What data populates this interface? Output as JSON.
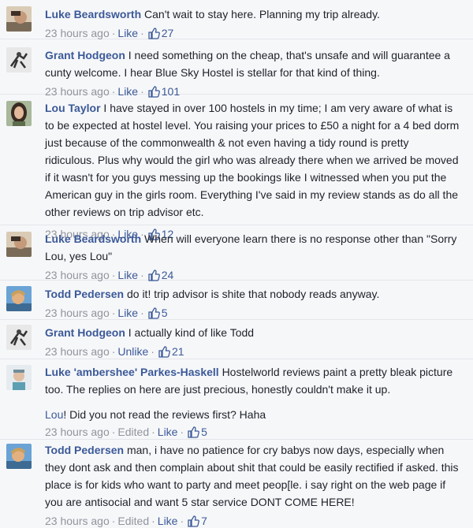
{
  "comments": [
    {
      "author": "Luke Beardsworth",
      "text": "Can't wait to stay here. Planning my trip already.",
      "time": "23 hours ago",
      "action": "Like",
      "likes": "27"
    },
    {
      "author": "Grant Hodgeon",
      "text": "I need something on the cheap, that's unsafe and will guarantee a cunty welcome. I hear Blue Sky Hostel is stellar for that kind of thing.",
      "time": "23 hours ago",
      "action": "Like",
      "likes": "101"
    },
    {
      "author": "Lou Taylor",
      "text": "I have stayed in over 100 hostels in my time; I am very aware of what is to be expected at hostel level. You raising your prices to £50 a night for a 4 bed dorm just because of the commonwealth & not even having a tidy round is pretty ridiculous. Plus why would the girl who was already there when we arrived be moved if it wasn't for you guys messing up the bookings like I witnessed when you put the American guy in the girls room. Everything I've said in my review stands as do all the other reviews on trip advisor etc.",
      "time": "23 hours ago",
      "action": "Like",
      "likes": "12"
    },
    {
      "author": "Luke Beardsworth",
      "text": "When will everyone learn there is no response other than \"Sorry Lou, yes Lou\"",
      "time": "23 hours ago",
      "action": "Like",
      "likes": "24"
    },
    {
      "author": "Todd Pedersen",
      "text": "do it! trip advisor is shite that nobody reads anyway.",
      "time": "23 hours ago",
      "action": "Like",
      "likes": "5"
    },
    {
      "author": "Grant Hodgeon",
      "text": "I actually kind of like Todd",
      "time": "23 hours ago",
      "action": "Unlike",
      "likes": "21"
    },
    {
      "author": "Luke 'ambershee' Parkes-Haskell",
      "text": "Hostelworld reviews paint a pretty bleak picture too. The replies on here are just precious, honestly couldn't make it up.",
      "reply_mention": "Lou",
      "reply_text": "! Did you not read the reviews first? Haha",
      "time": "23 hours ago",
      "edited": "Edited",
      "action": "Like",
      "likes": "5"
    },
    {
      "author": "Todd Pedersen",
      "text": "man, i have no patience for cry babys now days, especially when they dont ask and then complain about shit that could be easily rectified if asked. this place is for kids who want to party and meet peop[le. i say right on the web page if you are antisocial and want 5 star service DONT COME HERE!",
      "time": "23 hours ago",
      "edited": "Edited",
      "action": "Like",
      "likes": "7"
    }
  ],
  "meta_separator": "·"
}
